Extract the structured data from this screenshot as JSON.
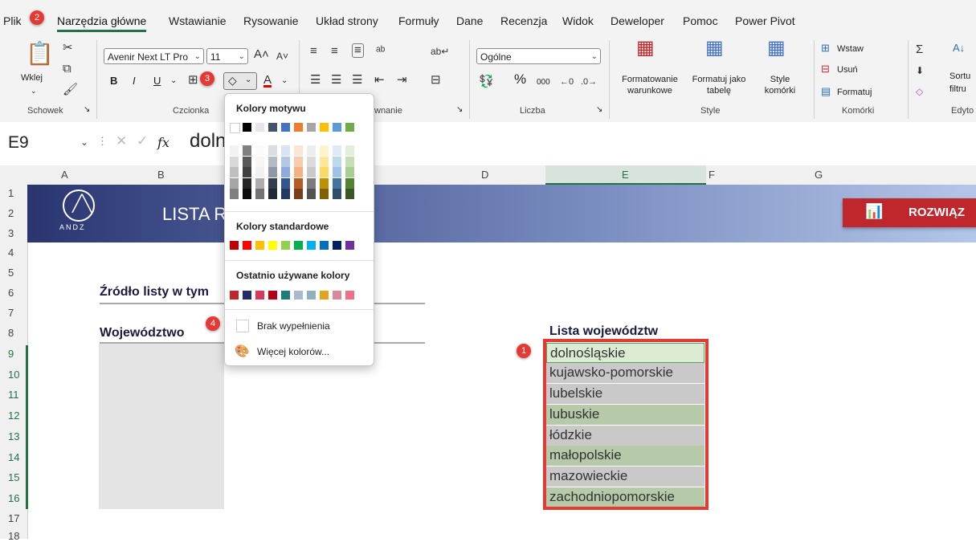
{
  "tabs": [
    "Plik",
    "Narzędzia główne",
    "Wstawianie",
    "Rysowanie",
    "Układ strony",
    "Formuły",
    "Dane",
    "Recenzja",
    "Widok",
    "Deweloper",
    "Pomoc",
    "Power Pivot"
  ],
  "ribbon": {
    "clipboard": {
      "paste": "Wklej",
      "label": "Schowek"
    },
    "font": {
      "name": "Avenir Next LT Pro",
      "size": "11",
      "bold": "B",
      "italic": "I",
      "underline": "U",
      "label": "Czcionka"
    },
    "alignment": {
      "label": "wnanie"
    },
    "number": {
      "format": "Ogólne",
      "percent": "%",
      "thousands": "000",
      "label": "Liczba"
    },
    "styles": {
      "conditional": "Formatowanie warunkowe",
      "table": "Formatuj jako tabelę",
      "cell_styles": "Style komórki",
      "label": "Style"
    },
    "cells": {
      "insert": "Wstaw",
      "delete": "Usuń",
      "format": "Formatuj",
      "label": "Komórki"
    },
    "editing": {
      "sort": "Sortu",
      "filter": "filtru",
      "label": "Edyto"
    }
  },
  "formula_bar": {
    "cell_ref": "E9",
    "fx": "fx",
    "content": "doln"
  },
  "columns": [
    "A",
    "B",
    "D",
    "E",
    "F",
    "G"
  ],
  "rows": [
    "1",
    "2",
    "3",
    "4",
    "5",
    "6",
    "7",
    "8",
    "9",
    "10",
    "11",
    "12",
    "13",
    "14",
    "15",
    "16",
    "17",
    "18"
  ],
  "banner": {
    "title": "LISTA R",
    "logo": "ANDZ",
    "button": "ROZWIĄZ"
  },
  "sheet": {
    "source_label": "Źródło listy w tym",
    "province_header": "Województwo",
    "list_header": "Lista województw",
    "provinces": [
      "dolnośląskie",
      "kujawsko-pomorskie",
      "lubelskie",
      "lubuskie",
      "łódzkie",
      "małopolskie",
      "mazowieckie",
      "zachodniopomorskie"
    ]
  },
  "dropdown": {
    "theme_label": "Kolory motywu",
    "standard_label": "Kolory standardowe",
    "recent_label": "Ostatnio używane kolory",
    "no_fill": "Brak wypełnienia",
    "more_colors": "Więcej kolorów...",
    "theme_colors": [
      "#ffffff",
      "#000000",
      "#e7e6e6",
      "#44546a",
      "#4472c4",
      "#ed7d31",
      "#a5a5a5",
      "#ffc000",
      "#5b9bd5",
      "#70ad47"
    ],
    "standard_colors": [
      "#c00000",
      "#ff0000",
      "#ffc000",
      "#ffff00",
      "#92d050",
      "#00b050",
      "#00b0f0",
      "#0070c0",
      "#002060",
      "#7030a0"
    ],
    "recent_colors": [
      "#c0272d",
      "#1f2a6b",
      "#d63a5a",
      "#b30012",
      "#1e7c7c",
      "#a9b9c9",
      "#8fb1bd",
      "#e3a21f",
      "#d58a9a",
      "#f07088"
    ]
  },
  "badges": [
    "1",
    "2",
    "3",
    "4"
  ]
}
